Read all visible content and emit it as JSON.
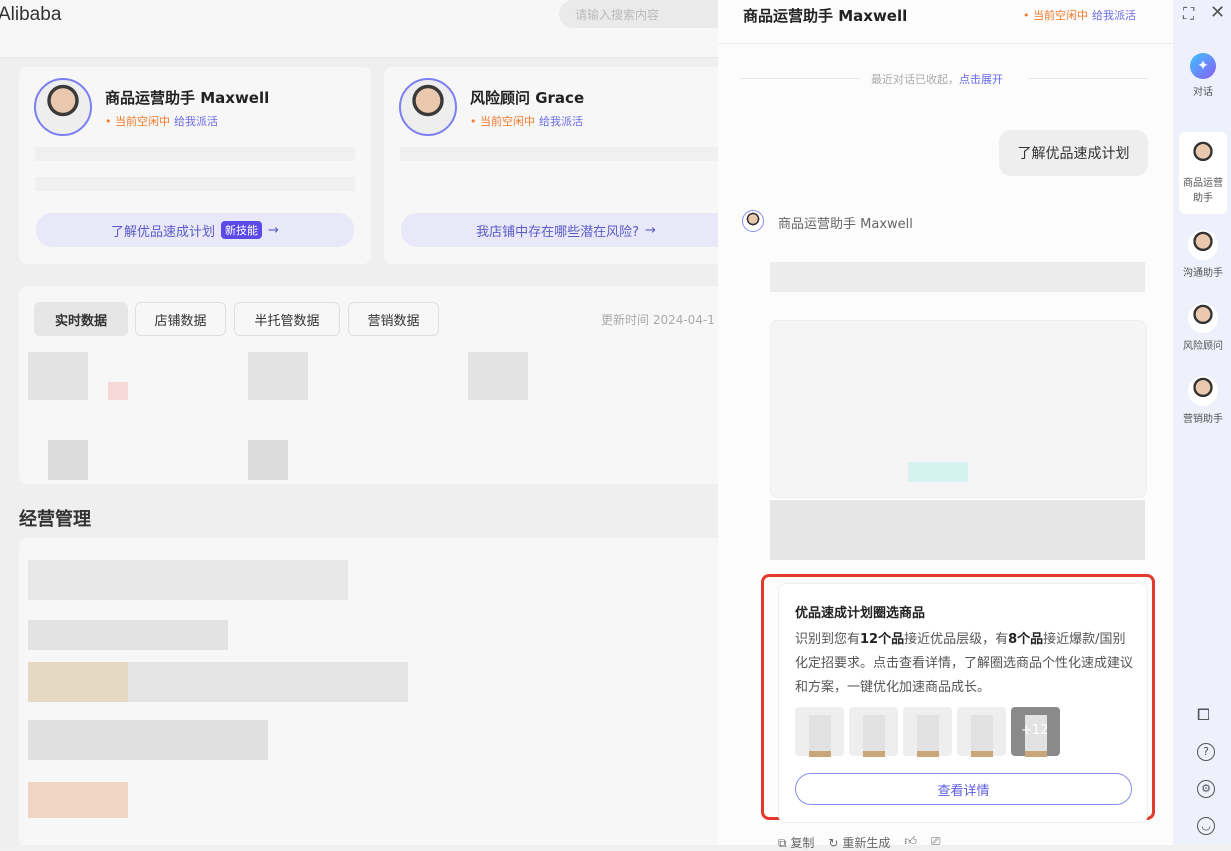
{
  "header": {
    "logo": "Alibaba",
    "search_placeholder": "请输入搜索内容"
  },
  "agents": [
    {
      "name": "商品运营助手 Maxwell",
      "status": "当前空闲中",
      "assign": "给我派活",
      "action": "了解优品速成计划",
      "badge": "新技能"
    },
    {
      "name": "风险顾问 Grace",
      "status": "当前空闲中",
      "assign": "给我派活",
      "action": "我店铺中存在哪些潜在风险?"
    }
  ],
  "data_tabs": [
    "实时数据",
    "店铺数据",
    "半托管数据",
    "营销数据"
  ],
  "update_time": "更新时间 2024-04-1",
  "section_title": "经营管理",
  "chat": {
    "title": "商品运营助手 Maxwell",
    "status": "当前空闲中",
    "assign": "给我派活",
    "collapsed_notice": "最近对话已收起，",
    "expand_link": "点击展开",
    "user_message": "了解优品速成计划",
    "bot_name": "商品运营助手 Maxwell",
    "card": {
      "title": "优品速成计划圈选商品",
      "body_1": "识别到您有",
      "bold_1": "12个品",
      "body_2": "接近优品层级，有",
      "bold_2": "8个品",
      "body_3": "接近爆款/国别化定招要求。点击查看详情，了解圈选商品个性化速成建议和方案，一键优化加速商品成长。",
      "more_count": "+12",
      "button": "查看详情"
    },
    "actions": {
      "copy": "复制",
      "regenerate": "重新生成"
    }
  },
  "rail": {
    "chat": "对话",
    "agents": [
      "商品运营助手",
      "沟通助手",
      "风险顾问",
      "营销助手"
    ]
  },
  "colors": {
    "accent": "#6a6ae8",
    "idle": "#f07a2a",
    "highlight": "#e23b2e"
  }
}
